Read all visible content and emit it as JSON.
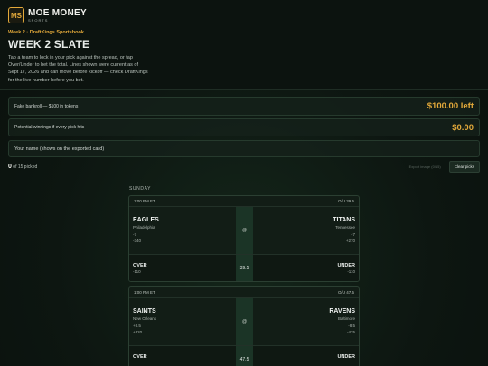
{
  "brand": {
    "logo": "MS",
    "name": "MOE MONEY",
    "sub": "SPORTS"
  },
  "header": {
    "week_label": "Week 2 · DraftKings Sportsbook",
    "title": "WEEK 2 SLATE",
    "intro": "Tap a team to lock in your pick against the spread, or tap Over/Under to bet the total. Lines shown were current as of Sept 17, 2026 and can move before kickoff — check DraftKings for the live number before you bet."
  },
  "bankroll": {
    "label": "Fake bankroll — $100 in tokens",
    "value": "$100.00 left"
  },
  "winnings": {
    "label": "Potential winnings if every pick hits",
    "value": "$0.00"
  },
  "name_field": {
    "placeholder": "Your name (shows on the exported card)"
  },
  "picks": {
    "count": "0",
    "total_text": "of 15 picked"
  },
  "actions": {
    "export": "Export image (0/15)",
    "clear": "Clear picks"
  },
  "day": "SUNDAY",
  "games": [
    {
      "time": "1:00 PM ET",
      "ou": "O/U 39.5",
      "away": {
        "name": "EAGLES",
        "city": "Philadelphia",
        "spread": "-7",
        "ml": "-340"
      },
      "home": {
        "name": "TITANS",
        "city": "Tennessee",
        "spread": "+7",
        "ml": "+270"
      },
      "at": "@",
      "total": "39.5",
      "over": {
        "label": "OVER",
        "odds": "-110"
      },
      "under": {
        "label": "UNDER",
        "odds": "-110"
      }
    },
    {
      "time": "1:00 PM ET",
      "ou": "O/U 47.5",
      "away": {
        "name": "SAINTS",
        "city": "New Orleans",
        "spread": "+8.5",
        "ml": "+320"
      },
      "home": {
        "name": "RAVENS",
        "city": "Baltimore",
        "spread": "-8.5",
        "ml": "-425"
      },
      "at": "@",
      "total": "47.5",
      "over": {
        "label": "OVER",
        "odds": ""
      },
      "under": {
        "label": "UNDER",
        "odds": ""
      }
    }
  ],
  "colors": {
    "accent": "#e3a93a",
    "background": "#0d1611",
    "highlight": "#1b3426"
  }
}
